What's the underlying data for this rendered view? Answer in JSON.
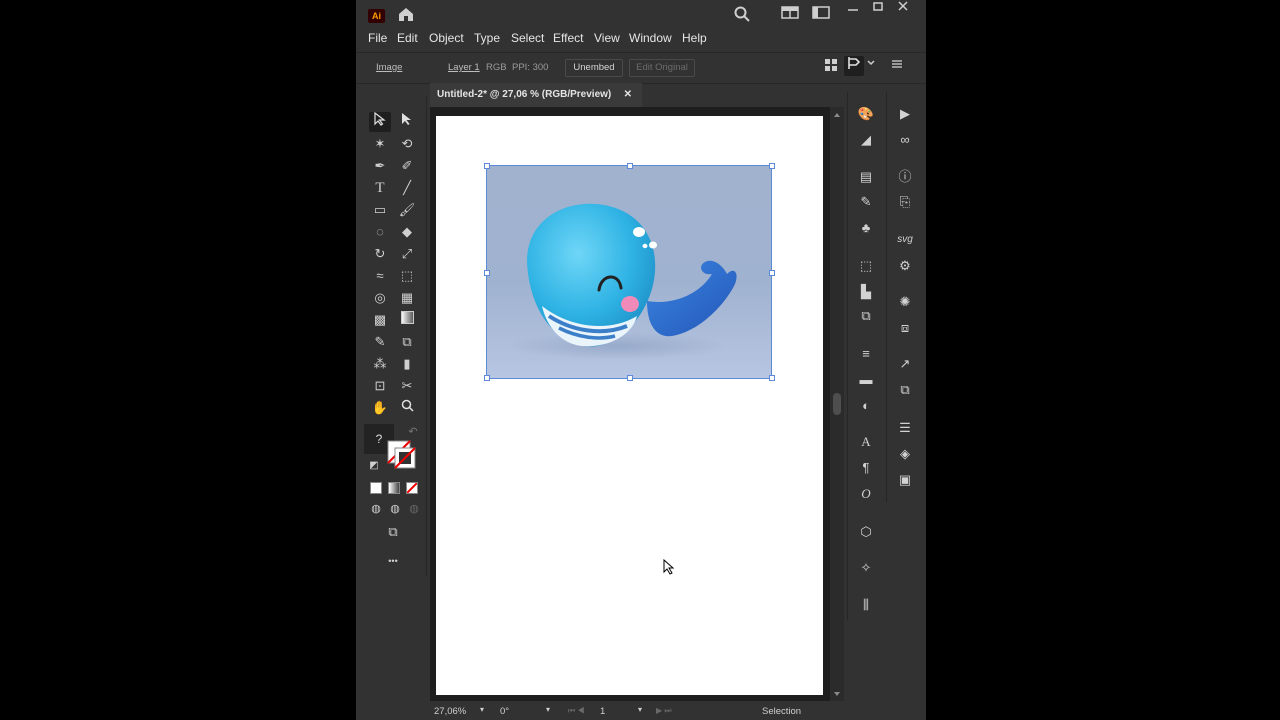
{
  "app": {
    "logo_text": "Ai",
    "title_icons": [
      "home-icon",
      "search-icon",
      "workspace-icon",
      "arrange-icon",
      "minimize-icon",
      "maximize-icon",
      "close-icon"
    ]
  },
  "menu": [
    "File",
    "Edit",
    "Object",
    "Type",
    "Select",
    "Effect",
    "View",
    "Window",
    "Help"
  ],
  "control_bar": {
    "object_type": "Image",
    "layer": "Layer 1",
    "color_mode": "RGB",
    "ppi": "PPI: 300",
    "unembed_label": "Unembed",
    "edit_original_label": "Edit Original"
  },
  "document": {
    "tab_title": "Untitled-2* @ 27,06 % (RGB/Preview)",
    "close_symbol": "✕"
  },
  "status_bar": {
    "zoom": "27,06%",
    "rotation": "0°",
    "artboard_number": "1",
    "tool_name": "Selection"
  },
  "toolbox": {
    "help_symbol": "?",
    "more_symbol": "•••"
  },
  "colors": {
    "selection": "#5c8ad6",
    "whale_body": "#3bb8e8",
    "whale_tail": "#2f6fd0",
    "cheek": "#f08ab8",
    "image_bg": "#a1b2ce"
  }
}
